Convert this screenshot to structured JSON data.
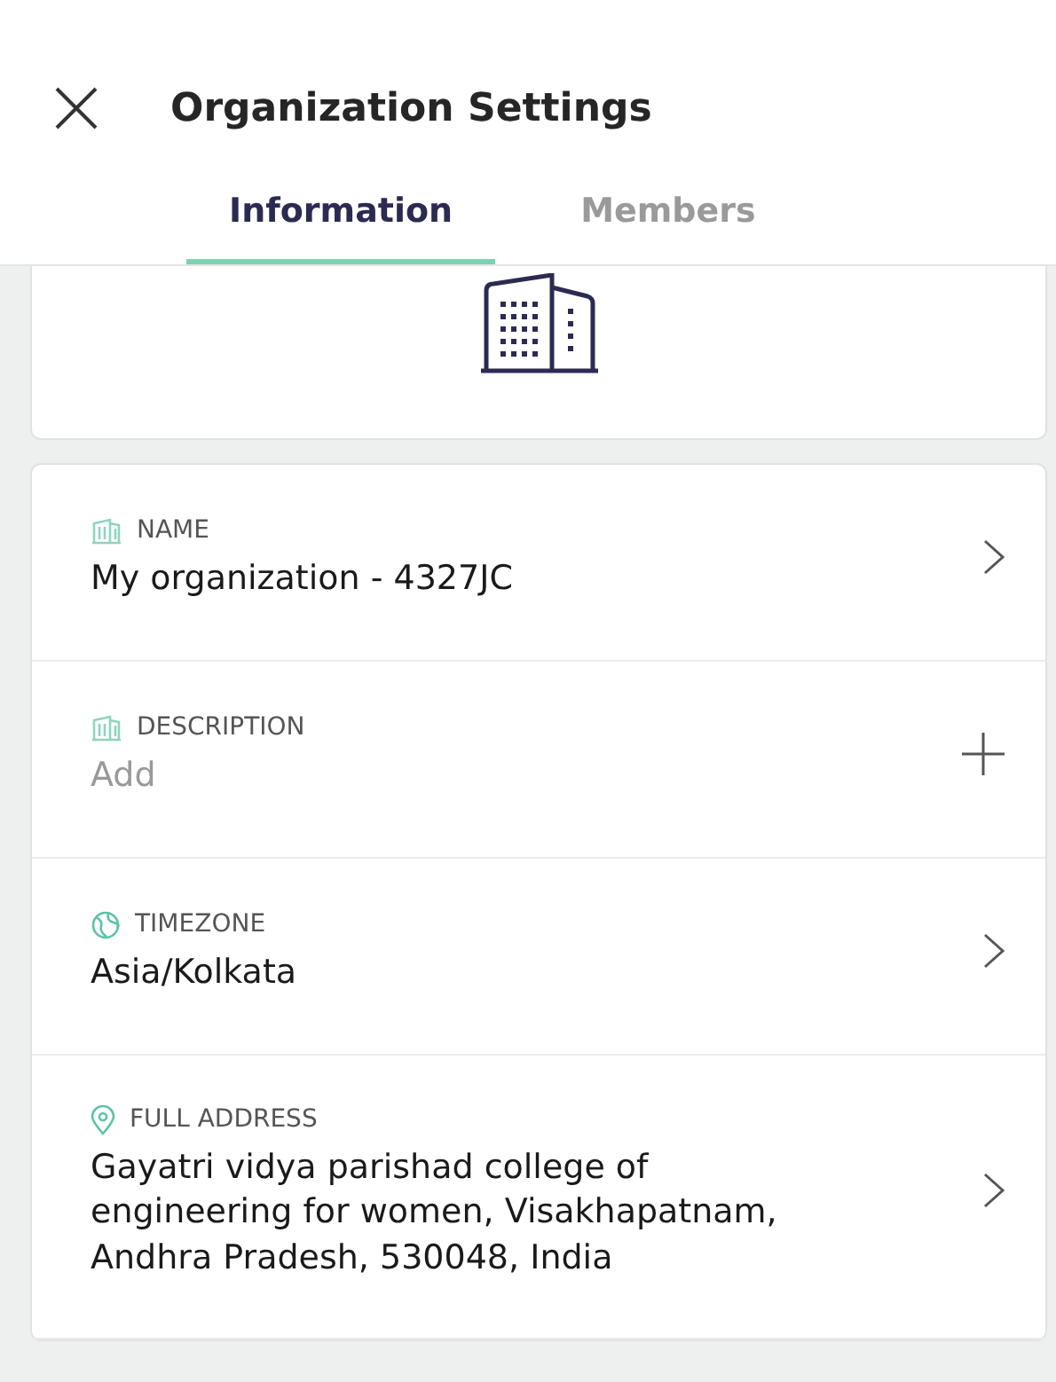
{
  "header": {
    "title": "Organization Settings"
  },
  "tabs": [
    {
      "label": "Information",
      "selected": true
    },
    {
      "label": "Members",
      "selected": false
    }
  ],
  "fields": [
    {
      "kind": "link",
      "label": "NAME",
      "value": "My organization - 4327JC"
    },
    {
      "kind": "add",
      "label": "DESCRIPTION",
      "value": "Add"
    },
    {
      "kind": "link",
      "label": "TIMEZONE",
      "value": "Asia/Kolkata"
    },
    {
      "kind": "link",
      "label": "FULL ADDRESS",
      "value": "Gayatri vidya parishad college of engineering for women, Visakhapatnam, Andhra Pradesh, 530048, India"
    }
  ]
}
